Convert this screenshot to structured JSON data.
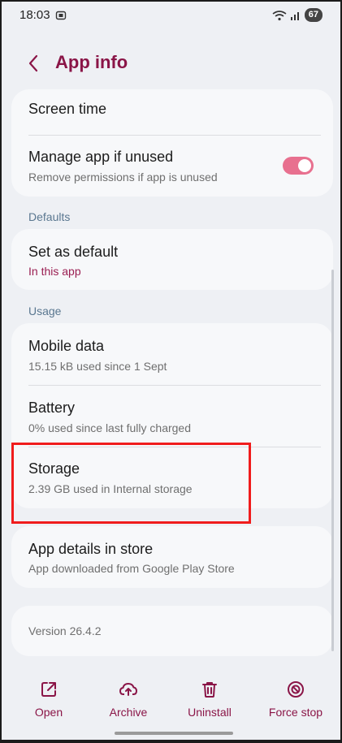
{
  "status_bar": {
    "time": "18:03",
    "battery": "67"
  },
  "header": {
    "title": "App info"
  },
  "sections": {
    "defaults_label": "Defaults",
    "usage_label": "Usage"
  },
  "items": {
    "screen_time": {
      "title": "Screen time"
    },
    "manage_app": {
      "title": "Manage app if unused",
      "subtitle": "Remove permissions if app is unused",
      "toggle_on": true
    },
    "set_default": {
      "title": "Set as default",
      "subtitle": "In this app"
    },
    "mobile_data": {
      "title": "Mobile data",
      "subtitle": "15.15 kB used since 1 Sept"
    },
    "battery": {
      "title": "Battery",
      "subtitle": "0% used since last fully charged"
    },
    "storage": {
      "title": "Storage",
      "subtitle": "2.39 GB used in Internal storage"
    },
    "app_details": {
      "title": "App details in store",
      "subtitle": "App downloaded from Google Play Store"
    },
    "version": {
      "text": "Version 26.4.2"
    }
  },
  "bottom_actions": {
    "open": "Open",
    "archive": "Archive",
    "uninstall": "Uninstall",
    "force_stop": "Force stop"
  },
  "colors": {
    "accent": "#8a1547",
    "toggle_on": "#e8708f",
    "highlight": "#f01c1c",
    "background": "#eef0f4",
    "card": "#f7f8fa"
  },
  "icons": {
    "back": "chevron-left-icon",
    "open": "open-external-icon",
    "archive": "cloud-upload-icon",
    "uninstall": "trash-icon",
    "force_stop": "stop-circle-icon"
  }
}
